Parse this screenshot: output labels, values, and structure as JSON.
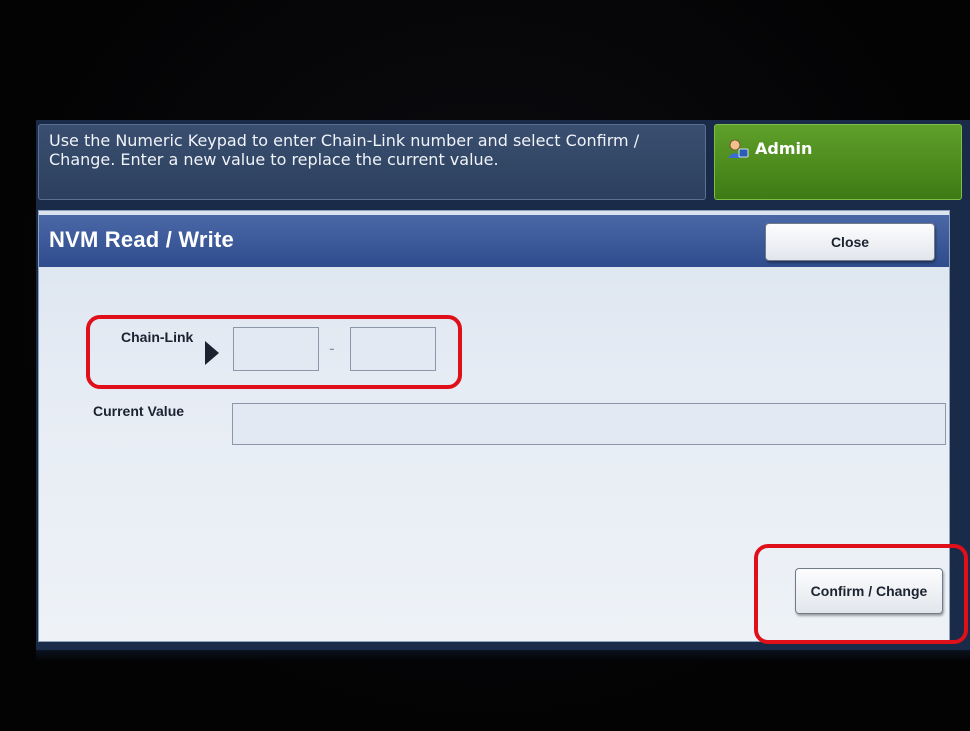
{
  "header": {
    "instruction": "Use the Numeric Keypad to enter Chain-Link number and select Confirm / Change.  Enter a new value to replace the current value.",
    "user_label": "Admin",
    "user_icon": "admin-user-icon"
  },
  "panel": {
    "title": "NVM Read / Write",
    "close_label": "Close"
  },
  "form": {
    "chain_link_label": "Chain-Link",
    "chain_link_first_value": "",
    "chain_link_second_value": "",
    "separator": "-",
    "current_value_label": "Current Value",
    "current_value": ""
  },
  "actions": {
    "confirm_label": "Confirm / Change"
  },
  "colors": {
    "title_bar": "#2f4d8e",
    "admin_bg": "#3f7a15",
    "highlight": "#e0101a"
  }
}
